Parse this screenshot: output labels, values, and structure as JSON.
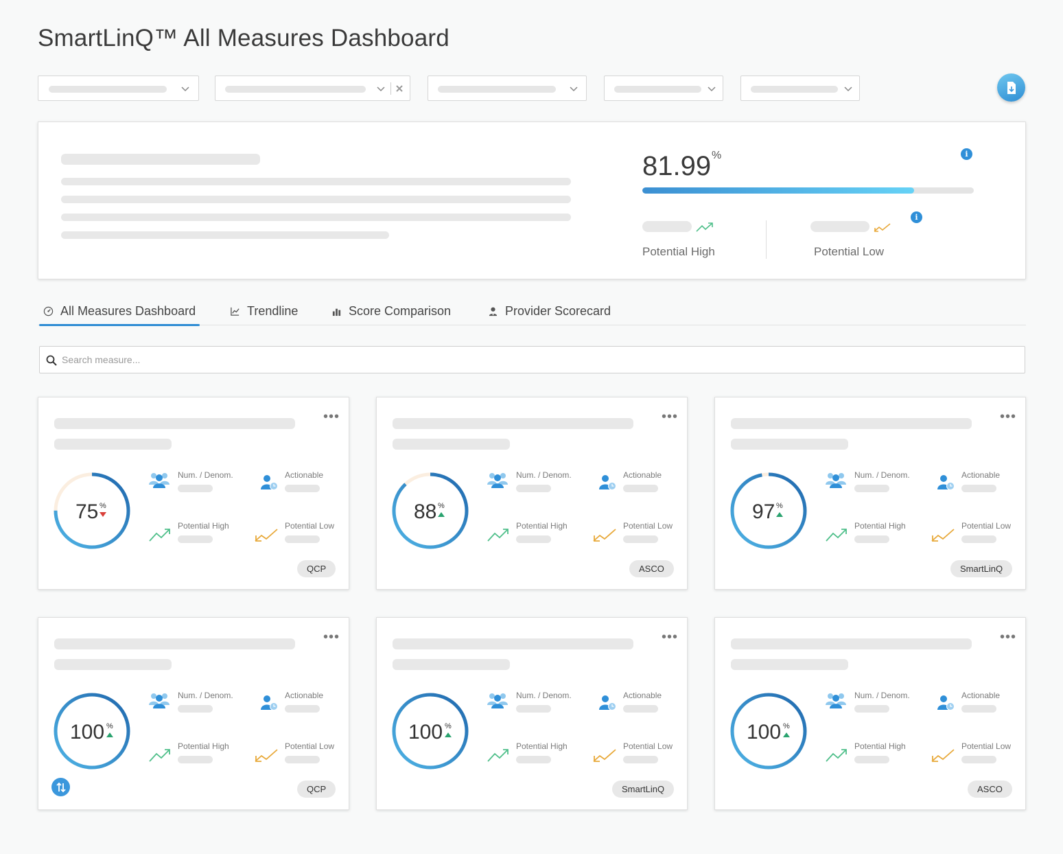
{
  "title": "SmartLinQ™ All Measures Dashboard",
  "summary": {
    "score": "81.99",
    "score_pct": "%",
    "progress": 0.8199,
    "potential_high_label": "Potential High",
    "potential_low_label": "Potential Low"
  },
  "tabs": [
    {
      "label": "All Measures Dashboard",
      "active": true
    },
    {
      "label": "Trendline",
      "active": false
    },
    {
      "label": "Score Comparison",
      "active": false
    },
    {
      "label": "Provider Scorecard",
      "active": false
    }
  ],
  "search": {
    "placeholder": "Search measure..."
  },
  "metric_labels": {
    "num_denom": "Num. / Denom.",
    "actionable": "Actionable",
    "potential_high": "Potential High",
    "potential_low": "Potential Low"
  },
  "cards": [
    {
      "value": "75",
      "pct": "%",
      "score": 75,
      "trend": "down",
      "badge": "QCP"
    },
    {
      "value": "88",
      "pct": "%",
      "score": 88,
      "trend": "up",
      "badge": "ASCO"
    },
    {
      "value": "97",
      "pct": "%",
      "score": 97,
      "trend": "up",
      "badge": "SmartLinQ"
    },
    {
      "value": "100",
      "pct": "%",
      "score": 100,
      "trend": "up",
      "badge": "QCP"
    },
    {
      "value": "100",
      "pct": "%",
      "score": 100,
      "trend": "up",
      "badge": "SmartLinQ"
    },
    {
      "value": "100",
      "pct": "%",
      "score": 100,
      "trend": "up",
      "badge": "ASCO"
    }
  ],
  "colors": {
    "accent": "#2c8bd3",
    "trend_up": "#2aa36f",
    "trend_down": "#d9403a",
    "potential_high": "#4fbf8a",
    "potential_low": "#e8a93a",
    "donut_remaining": "#fbeee0"
  }
}
